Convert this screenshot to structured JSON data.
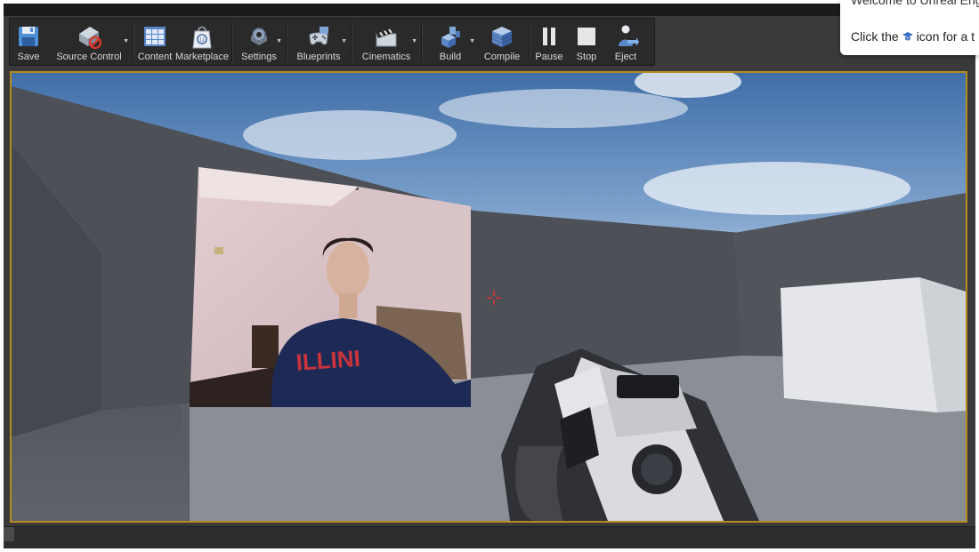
{
  "toolbar": {
    "buttons": [
      {
        "label": "Save"
      },
      {
        "label": "Source Control"
      },
      {
        "label": "Content"
      },
      {
        "label": "Marketplace"
      },
      {
        "label": "Settings"
      },
      {
        "label": "Blueprints"
      },
      {
        "label": "Cinematics"
      },
      {
        "label": "Build"
      },
      {
        "label": "Compile"
      },
      {
        "label": "Pause"
      },
      {
        "label": "Stop"
      },
      {
        "label": "Eject"
      }
    ]
  },
  "tutorial": {
    "title": "Welcome to Unreal Eng",
    "body_before": "Click the",
    "body_after": "icon for a t"
  },
  "colors": {
    "viewport_border": "#b58b1d",
    "popup_bg": "#ffffff",
    "toolbar_bg": "#2a2a2a"
  }
}
